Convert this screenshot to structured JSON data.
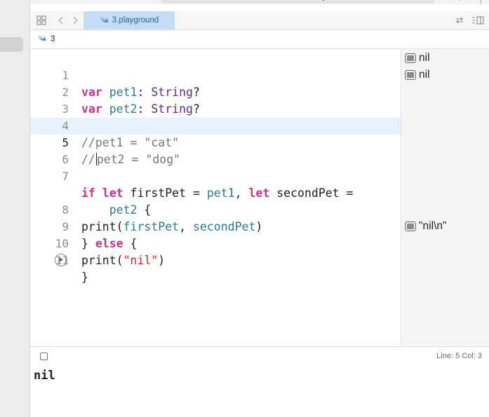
{
  "tab": {
    "label": "3.playground"
  },
  "jumpbar": {
    "label": "3"
  },
  "editor": {
    "lines": [
      {
        "num": "1",
        "t": [
          "var",
          " ",
          "pet1",
          ": ",
          "String",
          "?"
        ]
      },
      {
        "num": "2",
        "t": [
          "var",
          " ",
          "pet2",
          ": ",
          "String",
          "?"
        ]
      },
      {
        "num": "3",
        "t": []
      },
      {
        "num": "4",
        "t": [
          "//pet1 = \"cat\""
        ]
      },
      {
        "num": "5",
        "t": [
          "//",
          "pet2 = \"dog\""
        ]
      },
      {
        "num": "6",
        "t": []
      },
      {
        "num": "7",
        "t": [
          "if",
          " ",
          "let",
          " firstPet = ",
          "pet1",
          ", ",
          "let",
          " secondPet ="
        ]
      },
      {
        "num": "",
        "t": [
          "    ",
          "pet2",
          " {"
        ]
      },
      {
        "num": "8",
        "t": [
          "print(",
          "firstPet",
          ", ",
          "secondPet",
          ")"
        ]
      },
      {
        "num": "9",
        "t": [
          "} ",
          "else",
          " {"
        ]
      },
      {
        "num": "10",
        "t": [
          "print(",
          "\"nil\"",
          ")"
        ]
      },
      {
        "num": "11",
        "t": [
          "}"
        ]
      }
    ],
    "current_line": "5"
  },
  "results": {
    "r1": "nil",
    "r2": "nil",
    "r10": "\"nil\\n\""
  },
  "status": {
    "line_col": "Line: 5  Col: 3"
  },
  "console": {
    "output": "nil"
  },
  "icons": {
    "grid": "grid-icon",
    "back": "chevron-left-icon",
    "forward": "chevron-right-icon",
    "swift": "swift-icon",
    "refresh": "refresh-icon",
    "inspector": "inspector-icon",
    "run": "play-icon",
    "quicklook": "quick-look-icon"
  },
  "colors": {
    "keyword": "#c7338d",
    "type": "#5b2e92",
    "identifier": "#2a7c93",
    "string": "#cf2c1f",
    "comment": "#6e7780",
    "tab_active": "#c5dcf5",
    "line_highlight": "#e8f2fc"
  }
}
